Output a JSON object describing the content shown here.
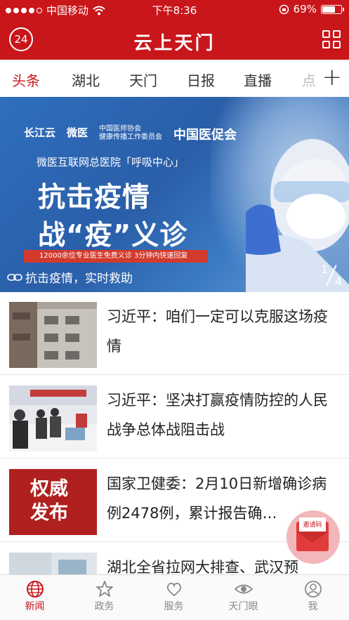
{
  "status_bar": {
    "carrier": "中国移动",
    "time": "下午8:36",
    "battery": "69%",
    "battery_level": 0.69
  },
  "header": {
    "date_badge": "24",
    "title": "云上天门"
  },
  "tabs": [
    {
      "label": "头条",
      "active": true
    },
    {
      "label": "湖北"
    },
    {
      "label": "天门"
    },
    {
      "label": "日报"
    },
    {
      "label": "直播"
    },
    {
      "label": "点"
    }
  ],
  "banner": {
    "partners": [
      "长江云",
      "微医",
      "中国医师协会",
      "健康传播工作委员会",
      "中国医促会"
    ],
    "hospital": "微医互联网总医院「呼吸中心」",
    "headline_line1": "抗击疫情",
    "headline_line2": "战“疫”义诊",
    "red_bar": "12000余位专业医生免费义诊 3分钟内快速回复",
    "caption": "抗击疫情，实时救助",
    "page_current": "1",
    "page_total": "4"
  },
  "news": [
    {
      "title": "习近平：咱们一定可以克服这场疫情"
    },
    {
      "title": "习近平：坚决打赢疫情防控的人民战争总体战阻击战"
    },
    {
      "title": "国家卫健委：2月10日新增确诊病例2478例，累计报告确…",
      "thumb_text_1": "权威",
      "thumb_text_2": "发布"
    },
    {
      "title": "湖北全省拉网大排查、武汉预"
    }
  ],
  "invite": {
    "label": "邀请码"
  },
  "bottom_nav": [
    {
      "label": "新闻",
      "icon": "globe-icon",
      "active": true
    },
    {
      "label": "政务",
      "icon": "star-icon"
    },
    {
      "label": "服务",
      "icon": "heart-icon"
    },
    {
      "label": "天门眼",
      "icon": "eye-icon"
    },
    {
      "label": "我",
      "icon": "user-icon"
    }
  ],
  "colors": {
    "brand": "#c8161b",
    "banner_blue": "#2e6fbd"
  }
}
